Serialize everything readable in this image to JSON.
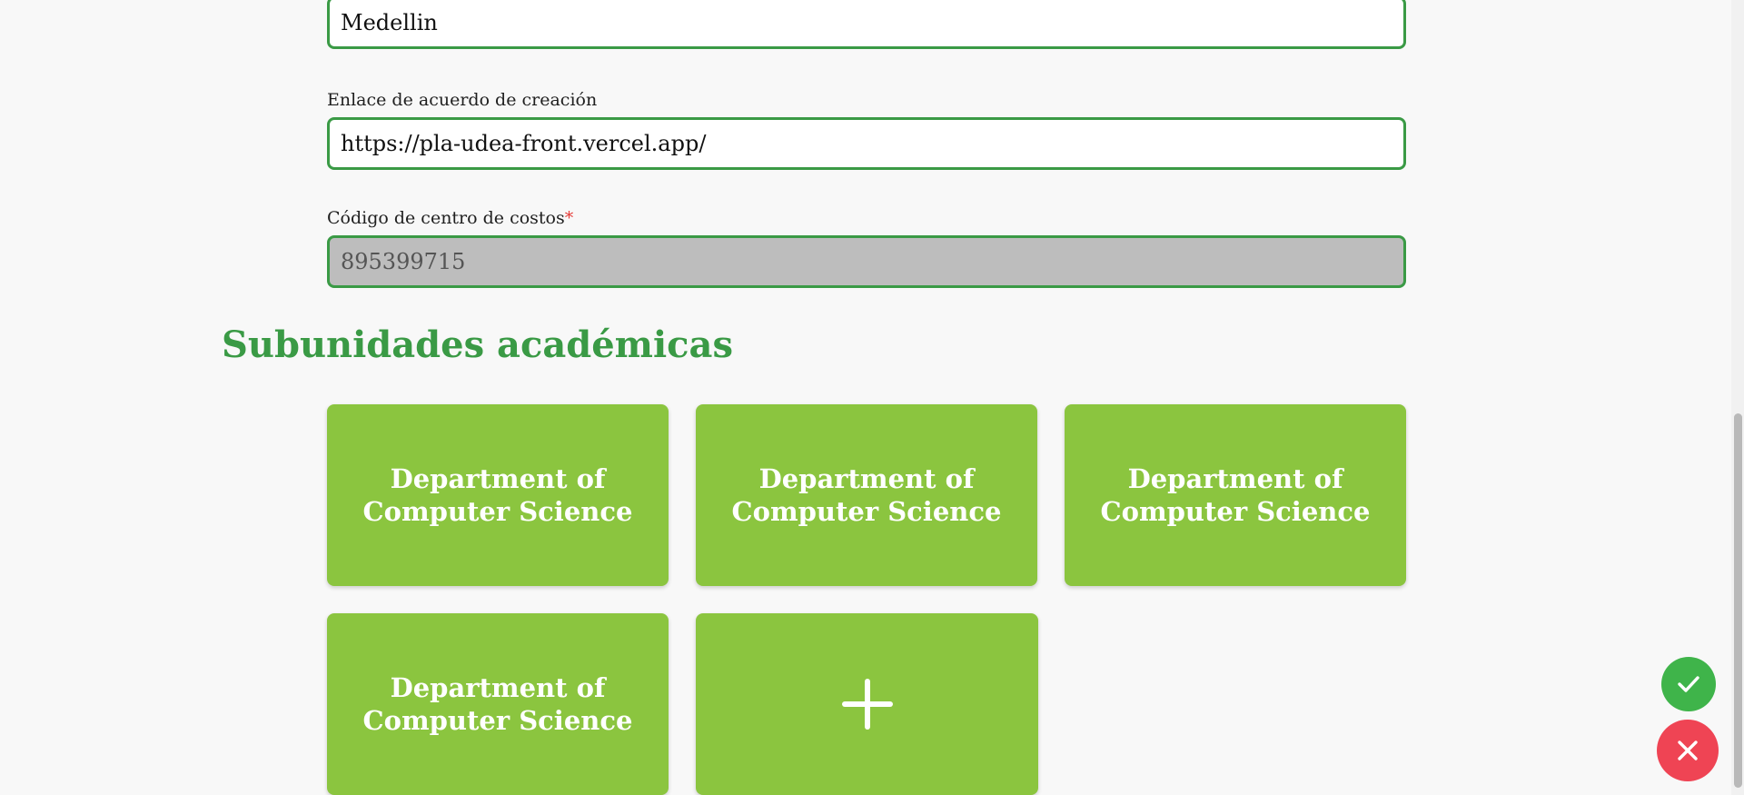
{
  "form": {
    "city": {
      "value": "Medellin"
    },
    "agreement_link": {
      "label": "Enlace de acuerdo de creación",
      "value": "https://pla-udea-front.vercel.app/"
    },
    "cost_center": {
      "label": "Código de centro de costos",
      "required_marker": "*",
      "value": "895399715"
    }
  },
  "subunits": {
    "title": "Subunidades académicas",
    "items": [
      {
        "line1": "Department of",
        "line2": "Computer Science"
      },
      {
        "line1": "Department of",
        "line2": "Computer Science"
      },
      {
        "line1": "Department of",
        "line2": "Computer Science"
      },
      {
        "line1": "Department of",
        "line2": "Computer Science"
      }
    ],
    "add_icon": "plus-icon"
  },
  "actions": {
    "confirm_icon": "check-icon",
    "cancel_icon": "close-icon"
  },
  "colors": {
    "accent_green": "#3a9a45",
    "card_green": "#8bc53f",
    "confirm_green": "#3fb44a",
    "cancel_red": "#ef4454",
    "disabled_gray": "#bdbdbd",
    "required_red": "#e53935"
  }
}
